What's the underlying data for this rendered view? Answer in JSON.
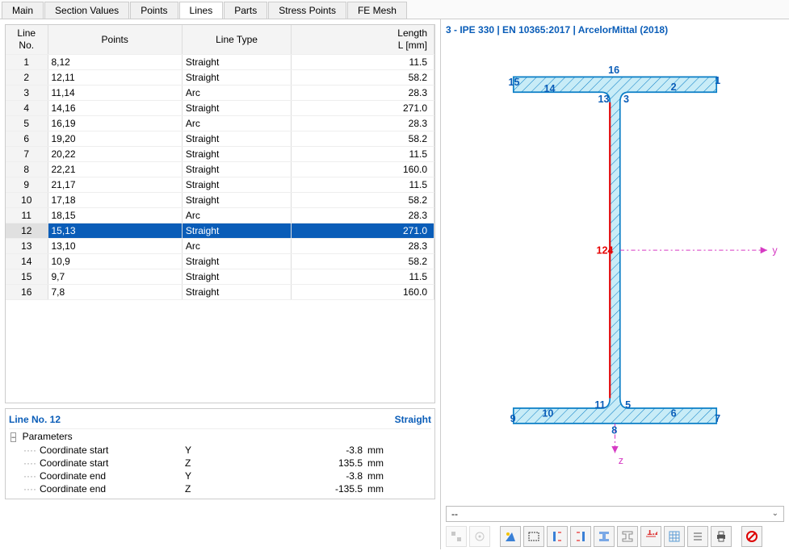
{
  "tabs": [
    "Main",
    "Section Values",
    "Points",
    "Lines",
    "Parts",
    "Stress Points",
    "FE Mesh"
  ],
  "active_tab": "Lines",
  "columns": {
    "no": "Line\nNo.",
    "points": "Points",
    "type": "Line Type",
    "length": "Length\nL [mm]"
  },
  "rows": [
    {
      "no": 1,
      "points": "8,12",
      "type": "Straight",
      "length": "11.5"
    },
    {
      "no": 2,
      "points": "12,11",
      "type": "Straight",
      "length": "58.2"
    },
    {
      "no": 3,
      "points": "11,14",
      "type": "Arc",
      "length": "28.3"
    },
    {
      "no": 4,
      "points": "14,16",
      "type": "Straight",
      "length": "271.0"
    },
    {
      "no": 5,
      "points": "16,19",
      "type": "Arc",
      "length": "28.3"
    },
    {
      "no": 6,
      "points": "19,20",
      "type": "Straight",
      "length": "58.2"
    },
    {
      "no": 7,
      "points": "20,22",
      "type": "Straight",
      "length": "11.5"
    },
    {
      "no": 8,
      "points": "22,21",
      "type": "Straight",
      "length": "160.0"
    },
    {
      "no": 9,
      "points": "21,17",
      "type": "Straight",
      "length": "11.5"
    },
    {
      "no": 10,
      "points": "17,18",
      "type": "Straight",
      "length": "58.2"
    },
    {
      "no": 11,
      "points": "18,15",
      "type": "Arc",
      "length": "28.3"
    },
    {
      "no": 12,
      "points": "15,13",
      "type": "Straight",
      "length": "271.0"
    },
    {
      "no": 13,
      "points": "13,10",
      "type": "Arc",
      "length": "28.3"
    },
    {
      "no": 14,
      "points": "10,9",
      "type": "Straight",
      "length": "58.2"
    },
    {
      "no": 15,
      "points": "9,7",
      "type": "Straight",
      "length": "11.5"
    },
    {
      "no": 16,
      "points": "7,8",
      "type": "Straight",
      "length": "160.0"
    }
  ],
  "selected_row": 12,
  "detail": {
    "title": "Line No. 12",
    "type": "Straight",
    "group": "Parameters",
    "params": [
      {
        "label": "Coordinate start",
        "axis": "Y",
        "value": "-3.8",
        "unit": "mm"
      },
      {
        "label": "Coordinate start",
        "axis": "Z",
        "value": "135.5",
        "unit": "mm"
      },
      {
        "label": "Coordinate end",
        "axis": "Y",
        "value": "-3.8",
        "unit": "mm"
      },
      {
        "label": "Coordinate end",
        "axis": "Z",
        "value": "-135.5",
        "unit": "mm"
      }
    ]
  },
  "preview": {
    "title": "3 - IPE 330 | EN 10365:2017 | ArcelorMittal (2018)",
    "center_label": "124",
    "y_axis": "y",
    "z_axis": "z",
    "points": [
      1,
      2,
      3,
      5,
      6,
      7,
      8,
      9,
      10,
      11,
      13,
      14,
      15,
      16
    ],
    "status": "--"
  },
  "toolbar": [
    {
      "name": "isolate-icon",
      "interact": false
    },
    {
      "name": "center-icon",
      "interact": false
    },
    {
      "sep": true
    },
    {
      "name": "view-render-icon",
      "interact": true
    },
    {
      "name": "print-area-icon",
      "interact": true
    },
    {
      "name": "stress-left-icon",
      "interact": true
    },
    {
      "name": "stress-right-icon",
      "interact": true
    },
    {
      "name": "ibeam-fill-icon",
      "interact": true
    },
    {
      "name": "ibeam-outline-icon",
      "interact": true
    },
    {
      "name": "dimensions-icon",
      "interact": true
    },
    {
      "name": "grid-icon",
      "interact": true
    },
    {
      "name": "list-icon",
      "interact": true
    },
    {
      "name": "print-icon",
      "interact": true
    },
    {
      "sep": true
    },
    {
      "name": "cancel-icon",
      "interact": true
    }
  ]
}
